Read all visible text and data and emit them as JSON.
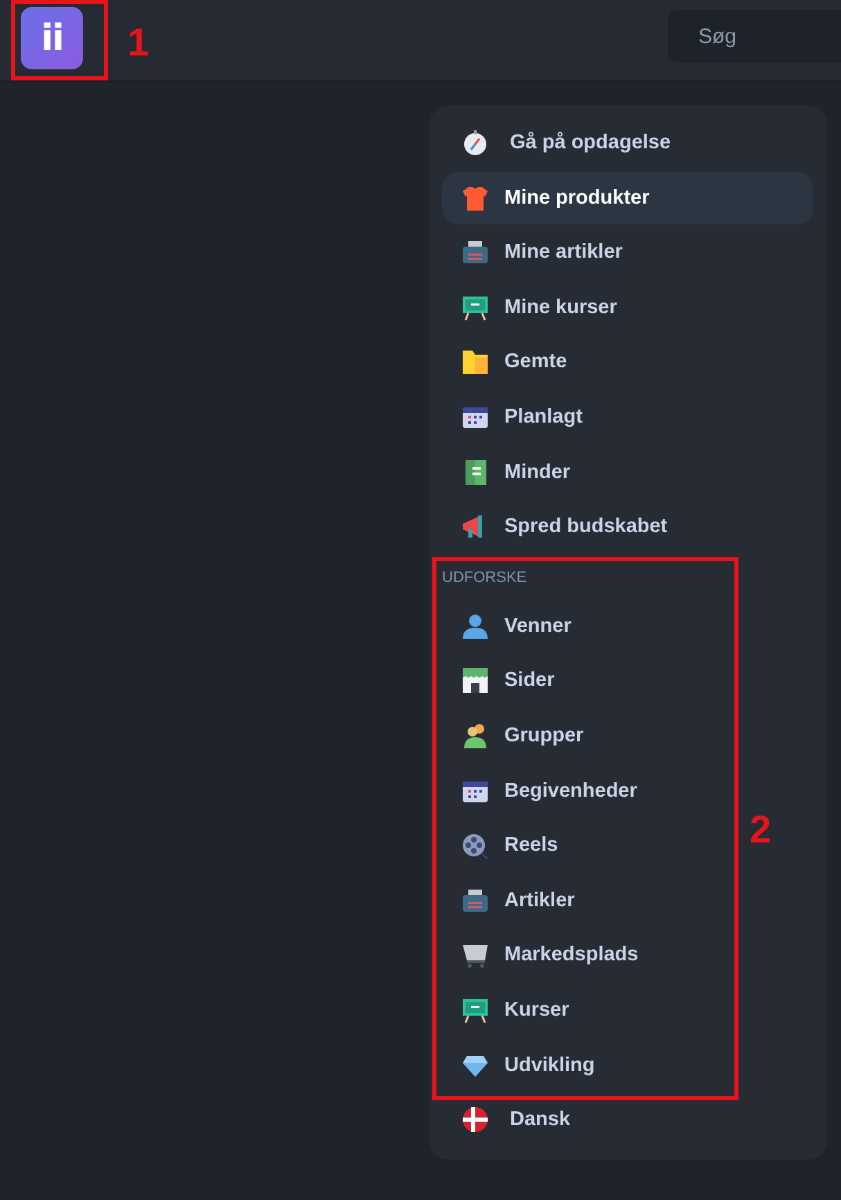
{
  "header": {
    "logo": "ii",
    "search": {
      "placeholder": "Søg"
    }
  },
  "menu": {
    "items": [
      {
        "label": "Gå på opdagelse",
        "selected": false
      },
      {
        "label": "Mine produkter",
        "selected": true
      },
      {
        "label": "Mine artikler",
        "selected": false
      },
      {
        "label": "Mine kurser",
        "selected": false
      },
      {
        "label": "Gemte",
        "selected": false
      },
      {
        "label": "Planlagt",
        "selected": false
      },
      {
        "label": "Minder",
        "selected": false
      },
      {
        "label": "Spred budskabet",
        "selected": false
      }
    ],
    "section": {
      "title": "UDFORSKE",
      "items": [
        {
          "label": "Venner",
          "selected": false
        },
        {
          "label": "Sider",
          "selected": false
        },
        {
          "label": "Grupper",
          "selected": false
        },
        {
          "label": "Begivenheder",
          "selected": false
        },
        {
          "label": "Reels",
          "selected": false
        },
        {
          "label": "Artikler",
          "selected": false
        },
        {
          "label": "Markedsplads",
          "selected": false
        },
        {
          "label": "Kurser",
          "selected": false
        },
        {
          "label": "Udvikling",
          "selected": false
        }
      ]
    },
    "language": {
      "label": "Dansk"
    }
  },
  "annotations": [
    {
      "label": "1"
    },
    {
      "label": "2"
    }
  ]
}
